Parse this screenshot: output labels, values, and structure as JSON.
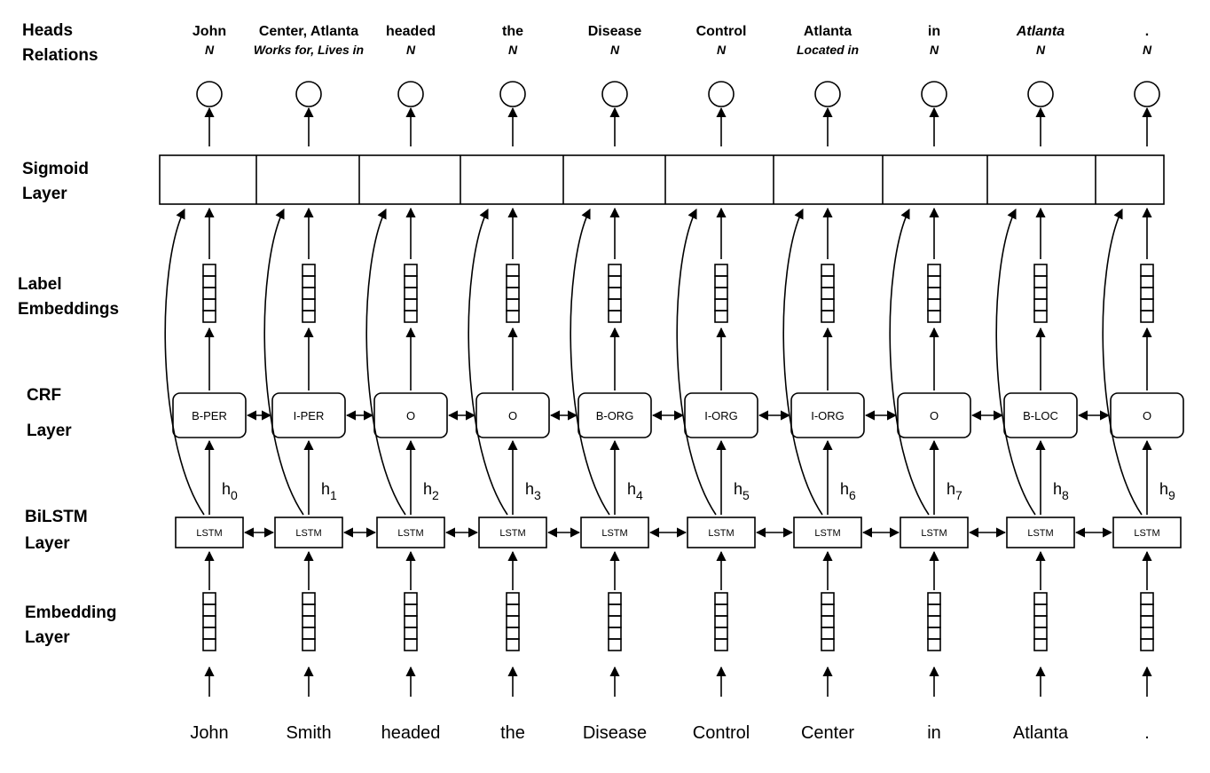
{
  "row_labels": {
    "heads": "Heads",
    "relations": "Relations",
    "sigmoid": [
      "Sigmoid",
      "Layer"
    ],
    "label_embeddings": [
      "Label",
      "Embeddings"
    ],
    "crf": [
      "CRF",
      "Layer"
    ],
    "bilstm": [
      "BiLSTM",
      "Layer"
    ],
    "embedding": [
      "Embedding",
      "Layer"
    ]
  },
  "lstm_label": "LSTM",
  "hidden_symbol": "h",
  "tokens": [
    {
      "word": "John",
      "head": "John",
      "relation": "N",
      "tag": "B-PER",
      "hidden_index": "0"
    },
    {
      "word": "Smith",
      "head": "Center, Atlanta",
      "relation": "Works for, Lives in",
      "tag": "I-PER",
      "hidden_index": "1"
    },
    {
      "word": "headed",
      "head": "headed",
      "relation": "N",
      "tag": "O",
      "hidden_index": "2"
    },
    {
      "word": "the",
      "head": "the",
      "relation": "N",
      "tag": "O",
      "hidden_index": "3"
    },
    {
      "word": "Disease",
      "head": "Disease",
      "relation": "N",
      "tag": "B-ORG",
      "hidden_index": "4"
    },
    {
      "word": "Control",
      "head": "Control",
      "relation": "N",
      "tag": "I-ORG",
      "hidden_index": "5"
    },
    {
      "word": "Center",
      "head": "Atlanta",
      "relation": "Located in",
      "tag": "I-ORG",
      "hidden_index": "6"
    },
    {
      "word": "in",
      "head": "in",
      "relation": "N",
      "tag": "O",
      "hidden_index": "7"
    },
    {
      "word": "Atlanta",
      "head": "Atlanta",
      "head_italic": true,
      "relation": "N",
      "tag": "B-LOC",
      "hidden_index": "8"
    },
    {
      "word": ".",
      "head": ".",
      "relation": "N",
      "tag": "O",
      "hidden_index": "9"
    }
  ]
}
